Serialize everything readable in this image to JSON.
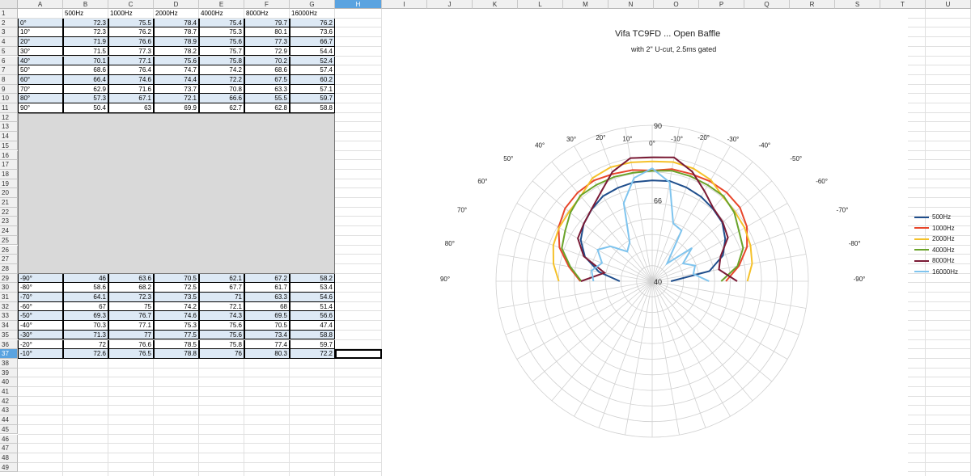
{
  "columns": [
    "A",
    "B",
    "C",
    "D",
    "E",
    "F",
    "G",
    "H",
    "I",
    "J",
    "K",
    "L",
    "M",
    "N",
    "O",
    "P",
    "Q",
    "R",
    "S",
    "T",
    "U"
  ],
  "selected_column": "H",
  "selected_row": "37",
  "header_row": [
    "",
    "500Hz",
    "1000Hz",
    "2000Hz",
    "4000Hz",
    "8000Hz",
    "16000Hz"
  ],
  "rows_top": [
    {
      "row": "2",
      "angle": "0°",
      "vals": [
        "72.3",
        "75.5",
        "78.4",
        "75.4",
        "79.7",
        "76.2"
      ]
    },
    {
      "row": "3",
      "angle": "10°",
      "vals": [
        "72.3",
        "76.2",
        "78.7",
        "75.3",
        "80.1",
        "73.6"
      ]
    },
    {
      "row": "4",
      "angle": "20°",
      "vals": [
        "71.9",
        "76.6",
        "78.9",
        "75.6",
        "77.3",
        "66.7"
      ]
    },
    {
      "row": "5",
      "angle": "30°",
      "vals": [
        "71.5",
        "77.3",
        "78.2",
        "75.7",
        "72.9",
        "54.4"
      ]
    },
    {
      "row": "6",
      "angle": "40°",
      "vals": [
        "70.1",
        "77.1",
        "75.6",
        "75.8",
        "70.2",
        "52.4"
      ]
    },
    {
      "row": "7",
      "angle": "50°",
      "vals": [
        "68.6",
        "76.4",
        "74.7",
        "74.2",
        "68.6",
        "57.4"
      ]
    },
    {
      "row": "8",
      "angle": "60°",
      "vals": [
        "66.4",
        "74.6",
        "74.4",
        "72.2",
        "67.5",
        "60.2"
      ]
    },
    {
      "row": "9",
      "angle": "70°",
      "vals": [
        "62.9",
        "71.6",
        "73.7",
        "70.8",
        "63.3",
        "57.1"
      ]
    },
    {
      "row": "10",
      "angle": "80°",
      "vals": [
        "57.3",
        "67.1",
        "72.1",
        "66.6",
        "55.5",
        "59.7"
      ]
    },
    {
      "row": "11",
      "angle": "90°",
      "vals": [
        "50.4",
        "63",
        "69.9",
        "62.7",
        "62.8",
        "58.8"
      ]
    }
  ],
  "rows_bottom": [
    {
      "row": "29",
      "angle": "-90°",
      "vals": [
        "46",
        "63.6",
        "70.5",
        "62.1",
        "67.2",
        "58.2"
      ]
    },
    {
      "row": "30",
      "angle": "-80°",
      "vals": [
        "58.6",
        "68.2",
        "72.5",
        "67.7",
        "61.7",
        "53.4"
      ]
    },
    {
      "row": "31",
      "angle": "-70°",
      "vals": [
        "64.1",
        "72.3",
        "73.5",
        "71",
        "63.3",
        "54.6"
      ]
    },
    {
      "row": "32",
      "angle": "-60°",
      "vals": [
        "67",
        "75",
        "74.2",
        "72.1",
        "68",
        "51.4"
      ]
    },
    {
      "row": "33",
      "angle": "-50°",
      "vals": [
        "69.3",
        "76.7",
        "74.6",
        "74.3",
        "69.5",
        "56.6"
      ]
    },
    {
      "row": "34",
      "angle": "-40°",
      "vals": [
        "70.3",
        "77.1",
        "75.3",
        "75.6",
        "70.5",
        "47.4"
      ]
    },
    {
      "row": "35",
      "angle": "-30°",
      "vals": [
        "71.3",
        "77",
        "77.5",
        "75.6",
        "73.4",
        "58.8"
      ]
    },
    {
      "row": "36",
      "angle": "-20°",
      "vals": [
        "72",
        "76.6",
        "78.5",
        "75.8",
        "77.4",
        "59.7"
      ]
    },
    {
      "row": "37",
      "angle": "-10°",
      "vals": [
        "72.6",
        "76.5",
        "78.8",
        "76",
        "80.3",
        "72.2"
      ]
    }
  ],
  "row_numbers": [
    "1",
    "2",
    "3",
    "4",
    "5",
    "6",
    "7",
    "8",
    "9",
    "10",
    "11",
    "12",
    "13",
    "14",
    "15",
    "16",
    "17",
    "18",
    "19",
    "20",
    "21",
    "22",
    "23",
    "24",
    "25",
    "26",
    "27",
    "28",
    "29",
    "30",
    "31",
    "32",
    "33",
    "34",
    "35",
    "36",
    "37",
    "38",
    "39",
    "40",
    "41",
    "42",
    "43",
    "44",
    "45",
    "46",
    "47",
    "48",
    "49"
  ],
  "chart_data": {
    "type": "line",
    "title": "Vifa TC9FD ... Open Baffle",
    "subtitle": "with 2\" U-cut, 2.5ms gated",
    "polar": true,
    "radial_range": [
      40,
      90
    ],
    "radial_tick_labels": [
      "40",
      "66",
      "90"
    ],
    "angle_labels": [
      "0°",
      "10°",
      "20°",
      "30°",
      "40°",
      "50°",
      "60°",
      "70°",
      "80°",
      "90°",
      "-10°",
      "-20°",
      "-30°",
      "-40°",
      "-50°",
      "-60°",
      "-70°",
      "-80°",
      "-90°"
    ],
    "angles": [
      -90,
      -80,
      -70,
      -60,
      -50,
      -40,
      -30,
      -20,
      -10,
      0,
      10,
      20,
      30,
      40,
      50,
      60,
      70,
      80,
      90
    ],
    "legend_position": "right",
    "series": [
      {
        "name": "500Hz",
        "color": "#1f4e8c",
        "values": [
          46,
          58.6,
          64.1,
          67,
          69.3,
          70.3,
          71.3,
          72,
          72.6,
          72.3,
          72.3,
          71.9,
          71.5,
          70.1,
          68.6,
          66.4,
          62.9,
          57.3,
          50.4
        ]
      },
      {
        "name": "1000Hz",
        "color": "#e8462b",
        "values": [
          63.6,
          68.2,
          72.3,
          75,
          76.7,
          77.1,
          77,
          76.6,
          76.5,
          75.5,
          76.2,
          76.6,
          77.3,
          77.1,
          76.4,
          74.6,
          71.6,
          67.1,
          63
        ]
      },
      {
        "name": "2000Hz",
        "color": "#f5c12a",
        "values": [
          70.5,
          72.5,
          73.5,
          74.2,
          74.6,
          75.3,
          77.5,
          78.5,
          78.8,
          78.4,
          78.7,
          78.9,
          78.2,
          75.6,
          74.7,
          74.4,
          73.7,
          72.1,
          69.9
        ]
      },
      {
        "name": "4000Hz",
        "color": "#6aa32a",
        "values": [
          62.1,
          67.7,
          71,
          72.1,
          74.3,
          75.6,
          75.6,
          75.8,
          76,
          75.4,
          75.3,
          75.6,
          75.7,
          75.8,
          74.2,
          72.2,
          70.8,
          66.6,
          62.7
        ]
      },
      {
        "name": "8000Hz",
        "color": "#7a1a35",
        "values": [
          67.2,
          61.7,
          63.3,
          68,
          69.5,
          70.5,
          73.4,
          77.4,
          80.3,
          79.7,
          80.1,
          77.3,
          72.9,
          70.2,
          68.6,
          67.5,
          63.3,
          55.5,
          62.8
        ]
      },
      {
        "name": "16000Hz",
        "color": "#7fc4ee",
        "values": [
          58.2,
          53.4,
          54.6,
          51.4,
          56.6,
          47.4,
          58.8,
          59.7,
          72.2,
          76.2,
          73.6,
          66.7,
          54.4,
          52.4,
          57.4,
          60.2,
          57.1,
          59.7,
          58.8
        ]
      }
    ]
  }
}
